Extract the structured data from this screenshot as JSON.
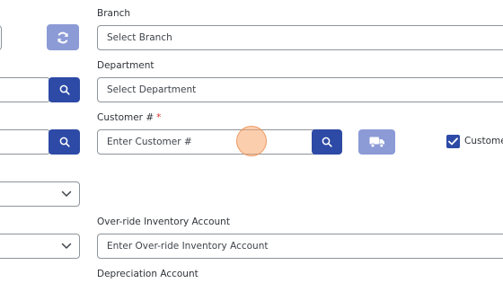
{
  "branch": {
    "label": "Branch",
    "placeholder": "Select Branch"
  },
  "department": {
    "label": "Department",
    "placeholder": "Select Department"
  },
  "customer": {
    "label": "Customer #",
    "required_mark": "*",
    "placeholder": "Enter Customer #",
    "checkbox_label": "Customer"
  },
  "override_inventory": {
    "label": "Over-ride Inventory Account",
    "placeholder": "Enter Over-ride Inventory Account"
  },
  "depreciation": {
    "label": "Depreciation Account"
  },
  "icons": {
    "refresh": "refresh-icon",
    "search": "search-icon",
    "truck": "truck-icon",
    "chevron": "chevron-down-icon",
    "check": "check-icon"
  },
  "colors": {
    "primary": "#2d4aa6",
    "primary_light": "#8c9bd6",
    "required": "#d9342b",
    "border": "#8e949b"
  }
}
